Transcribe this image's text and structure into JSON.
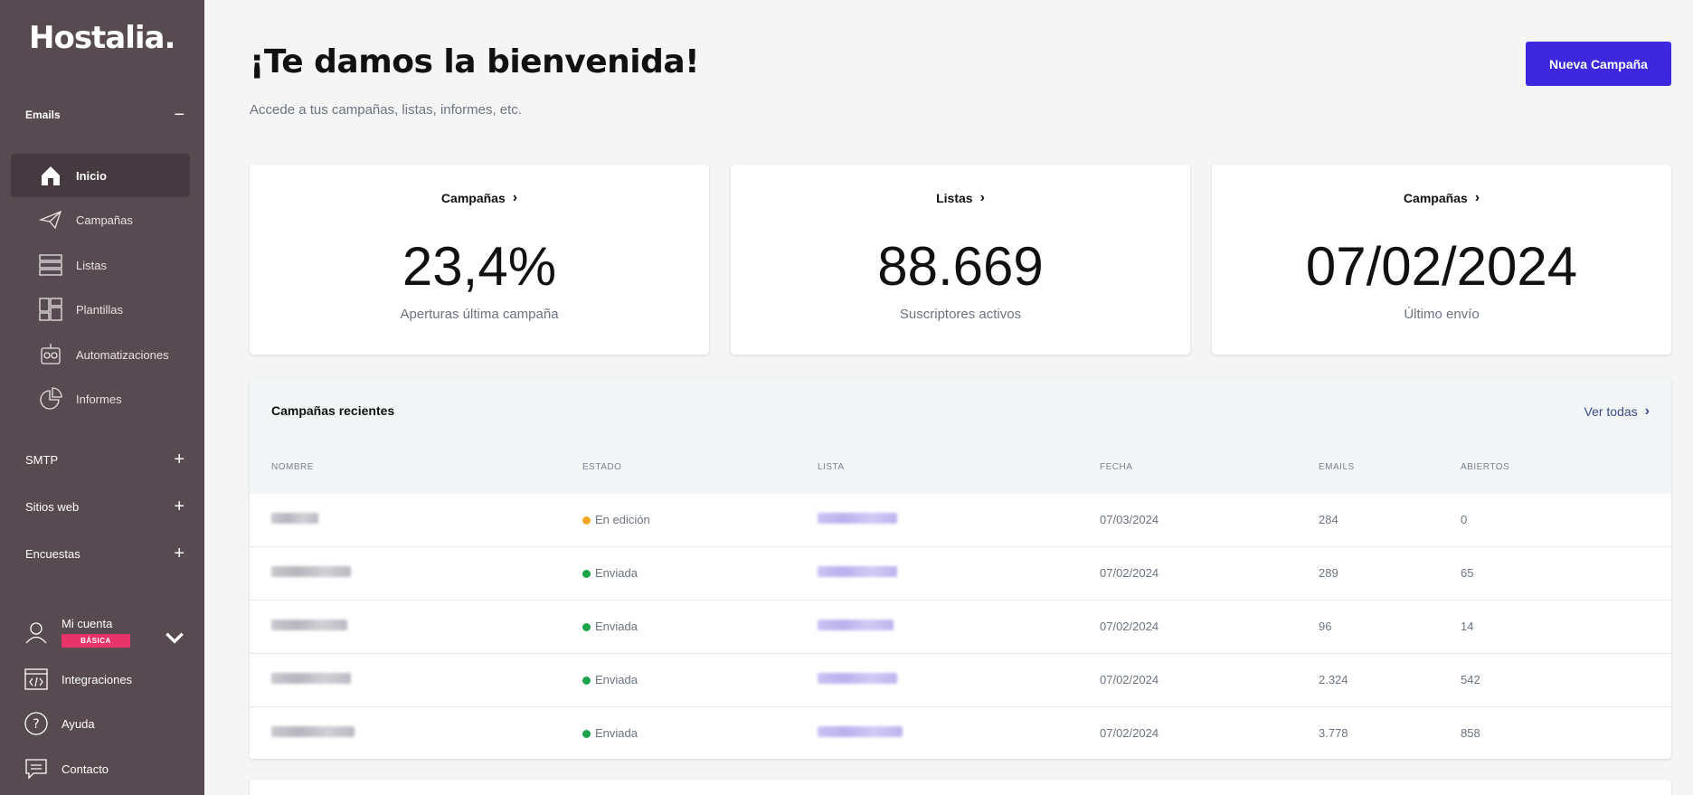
{
  "sidebar": {
    "logo": "Hostalia.",
    "emails_section": {
      "label": "Emails",
      "toggle": "−"
    },
    "nav": [
      {
        "label": "Inicio",
        "icon": "home-icon"
      },
      {
        "label": "Campañas",
        "icon": "paper-plane-icon"
      },
      {
        "label": "Listas",
        "icon": "list-icon"
      },
      {
        "label": "Plantillas",
        "icon": "template-icon"
      },
      {
        "label": "Automatizaciones",
        "icon": "robot-icon"
      },
      {
        "label": "Informes",
        "icon": "pie-chart-icon"
      }
    ],
    "sections": [
      {
        "label": "SMTP",
        "toggle": "+"
      },
      {
        "label": "Sitios web",
        "toggle": "+"
      },
      {
        "label": "Encuestas",
        "toggle": "+"
      }
    ],
    "account": {
      "label": "Mi cuenta",
      "badge": "BÁSICA"
    },
    "bottom": [
      {
        "label": "Integraciones",
        "icon": "code-window-icon"
      },
      {
        "label": "Ayuda",
        "icon": "help-icon"
      },
      {
        "label": "Contacto",
        "icon": "chat-icon"
      }
    ]
  },
  "header": {
    "title": "¡Te damos la bienvenida!",
    "subtitle": "Accede a tus campañas, listas, informes, etc.",
    "new_campaign": "Nueva Campaña"
  },
  "cards": [
    {
      "heading": "Campañas",
      "value": "23,4%",
      "label": "Aperturas última campaña"
    },
    {
      "heading": "Listas",
      "value": "88.669",
      "label": "Suscriptores activos"
    },
    {
      "heading": "Campañas",
      "value": "07/02/2024",
      "label": "Último envío"
    }
  ],
  "recent": {
    "title": "Campañas recientes",
    "view_all": "Ver todas",
    "columns": [
      "NOMBRE",
      "ESTADO",
      "LISTA",
      "FECHA",
      "EMAILS",
      "ABIERTOS"
    ],
    "rows": [
      {
        "estado": "En edición",
        "status_color": "#f5a623",
        "fecha": "07/03/2024",
        "emails": "284",
        "abiertos": "0"
      },
      {
        "estado": "Enviada",
        "status_color": "#1aa34a",
        "fecha": "07/02/2024",
        "emails": "289",
        "abiertos": "65"
      },
      {
        "estado": "Enviada",
        "status_color": "#1aa34a",
        "fecha": "07/02/2024",
        "emails": "96",
        "abiertos": "14"
      },
      {
        "estado": "Enviada",
        "status_color": "#1aa34a",
        "fecha": "07/02/2024",
        "emails": "2.324",
        "abiertos": "542"
      },
      {
        "estado": "Enviada",
        "status_color": "#1aa34a",
        "fecha": "07/02/2024",
        "emails": "3.778",
        "abiertos": "858"
      }
    ]
  }
}
